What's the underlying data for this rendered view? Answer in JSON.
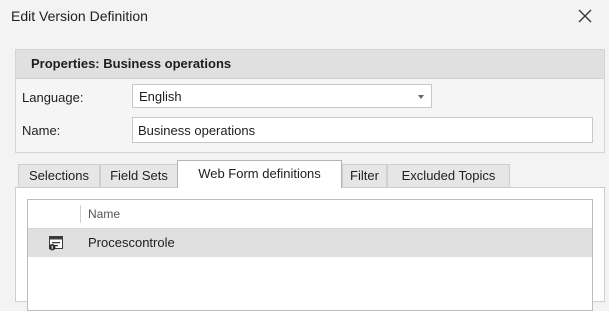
{
  "window": {
    "title": "Edit Version Definition"
  },
  "properties": {
    "header": "Properties: Business operations",
    "language_label": "Language:",
    "language_value": "English",
    "name_label": "Name:",
    "name_value": "Business operations"
  },
  "tabs": [
    {
      "label": "Selections",
      "active": false
    },
    {
      "label": "Field Sets",
      "active": false
    },
    {
      "label": "Web Form definitions",
      "active": true
    },
    {
      "label": "Filter",
      "active": false
    },
    {
      "label": "Excluded Topics",
      "active": false
    }
  ],
  "grid": {
    "column_name": "Name",
    "rows": [
      {
        "name": "Procescontrole",
        "icon": "web-form-icon",
        "selected": true
      }
    ]
  }
}
